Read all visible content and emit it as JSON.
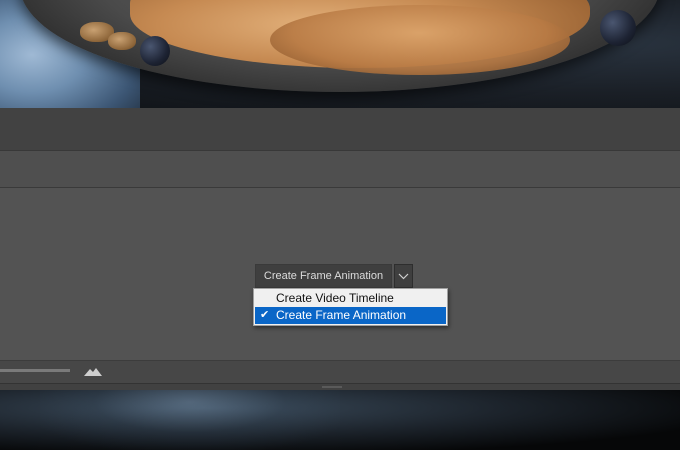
{
  "timeline_panel": {
    "create_button_label": "Create Frame Animation",
    "dropdown": {
      "items": [
        {
          "label": "Create Video Timeline",
          "selected": false
        },
        {
          "label": "Create Frame Animation",
          "selected": true
        }
      ],
      "check_glyph": "✔"
    }
  },
  "icons": {
    "dropdown_toggle": "chevron-down-icon",
    "zoom_mountains": "mountains-icon",
    "check": "checkmark-icon"
  },
  "colors": {
    "panel_bg": "#535353",
    "menu_bg": "#f0f0f0",
    "selection_blue": "#0a66c7"
  }
}
